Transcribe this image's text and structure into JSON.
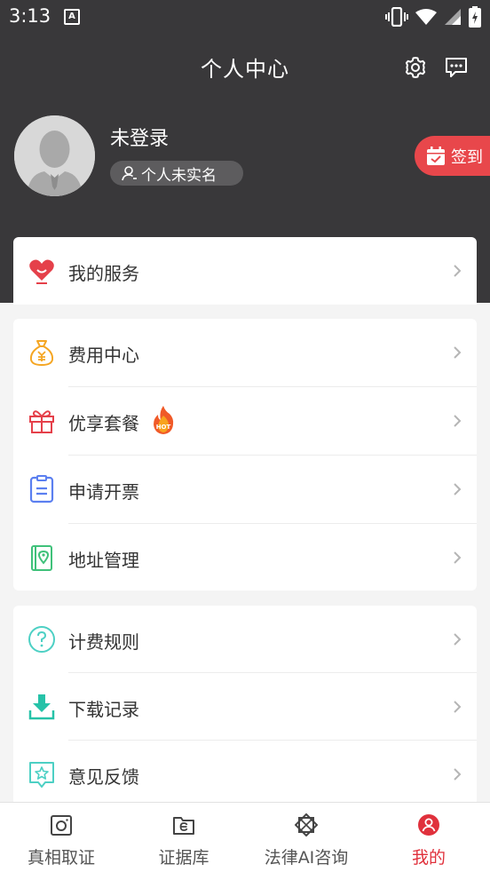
{
  "status_bar": {
    "time": "3:13",
    "notif_letter": "A"
  },
  "header": {
    "title": "个人中心"
  },
  "user": {
    "name": "未登录",
    "verify_status": "个人未实名"
  },
  "signin": {
    "label": "签到"
  },
  "services": {
    "label": "我的服务"
  },
  "group1": [
    {
      "label": "费用中心",
      "icon": "money-bag-icon"
    },
    {
      "label": "优享套餐",
      "icon": "gift-icon",
      "badge": "HOT"
    },
    {
      "label": "申请开票",
      "icon": "invoice-icon"
    },
    {
      "label": "地址管理",
      "icon": "address-book-icon"
    }
  ],
  "group2": [
    {
      "label": "计费规则",
      "icon": "question-icon"
    },
    {
      "label": "下载记录",
      "icon": "download-icon"
    },
    {
      "label": "意见反馈",
      "icon": "feedback-star-icon"
    }
  ],
  "tabs": [
    {
      "label": "真相取证",
      "icon": "camera-icon"
    },
    {
      "label": "证据库",
      "icon": "evidence-folder-icon"
    },
    {
      "label": "法律AI咨询",
      "icon": "ai-law-icon"
    },
    {
      "label": "我的",
      "icon": "profile-icon",
      "active": true
    }
  ],
  "colors": {
    "header_bg": "#39383a",
    "accent_red": "#e0313c",
    "signin_bg": "#e8474b"
  }
}
